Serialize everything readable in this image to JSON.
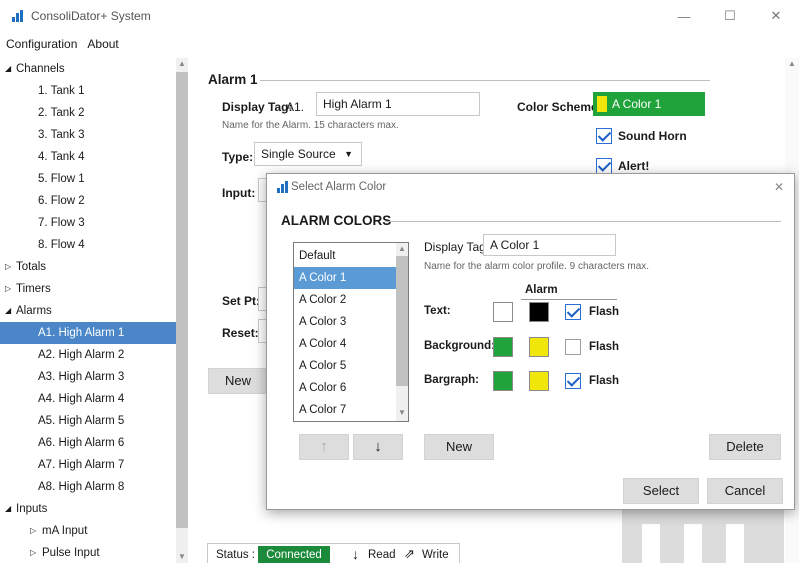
{
  "window": {
    "title": "ConsoliDator+ System",
    "minimize_glyph": "—",
    "maximize_glyph": "☐",
    "close_glyph": "✕"
  },
  "menu": [
    "Configuration",
    "About"
  ],
  "tree": [
    {
      "label": "Channels",
      "level": 0,
      "toggle": "◢"
    },
    {
      "label": "1. Tank 1",
      "level": 1
    },
    {
      "label": "2. Tank 2",
      "level": 1
    },
    {
      "label": "3. Tank  3",
      "level": 1
    },
    {
      "label": "4. Tank 4",
      "level": 1
    },
    {
      "label": "5. Flow 1",
      "level": 1
    },
    {
      "label": "6. Flow 2",
      "level": 1
    },
    {
      "label": "7. Flow 3",
      "level": 1
    },
    {
      "label": "8. Flow 4",
      "level": 1
    },
    {
      "label": "Totals",
      "level": 0,
      "toggle": "▷"
    },
    {
      "label": "Timers",
      "level": 0,
      "toggle": "▷"
    },
    {
      "label": "Alarms",
      "level": 0,
      "toggle": "◢"
    },
    {
      "label": "A1. High Alarm 1",
      "level": 1,
      "selected": true
    },
    {
      "label": "A2. High Alarm 2",
      "level": 1
    },
    {
      "label": "A3. High Alarm 3",
      "level": 1
    },
    {
      "label": "A4. High Alarm 4",
      "level": 1
    },
    {
      "label": "A5. High Alarm 5",
      "level": 1
    },
    {
      "label": "A6. High Alarm 6",
      "level": 1
    },
    {
      "label": "A7. High Alarm 7",
      "level": 1
    },
    {
      "label": "A8. High Alarm 8",
      "level": 1
    },
    {
      "label": "Inputs",
      "level": 0,
      "toggle": "◢"
    },
    {
      "label": "mA Input",
      "level": 1,
      "toggle": "▷"
    },
    {
      "label": "Pulse Input",
      "level": 1,
      "toggle": "▷"
    }
  ],
  "alarm": {
    "section_title": "Alarm 1",
    "display_tag_label": "Display Tag:",
    "display_tag_prefix": "A1.",
    "display_tag_value": "High Alarm 1",
    "display_tag_hint": "Name for the Alarm. 15 characters max.",
    "color_scheme_label": "Color Scheme:",
    "color_scheme_value": "A Color 1",
    "sound_horn_label": "Sound Horn",
    "alert_label": "Alert!",
    "type_label": "Type:",
    "type_value": "Single Source",
    "input_label": "Input:",
    "set_pt_label": "Set Pt:",
    "reset_label": "Reset:",
    "new_button": "New"
  },
  "status": {
    "label": "Status :",
    "value": "Connected",
    "read": "Read",
    "write": "Write"
  },
  "dialog": {
    "title": "Select Alarm Color",
    "section_title": "ALARM COLORS",
    "list": [
      "Default",
      "A Color 1",
      "A Color 2",
      "A Color 3",
      "A Color 4",
      "A Color 5",
      "A Color 6",
      "A Color 7"
    ],
    "selected_index": 1,
    "display_tag_label": "Display Tag:",
    "display_tag_value": "A Color 1",
    "display_tag_hint": "Name for the alarm color profile. 9 characters max.",
    "alarm_header": "Alarm",
    "rows": [
      {
        "label": "Text:",
        "normal_color": "#ffffff",
        "alarm_color": "#000000",
        "flash": true
      },
      {
        "label": "Background:",
        "normal_color": "#1fa33a",
        "alarm_color": "#f0e60a",
        "flash": false
      },
      {
        "label": "Bargraph:",
        "normal_color": "#1fa33a",
        "alarm_color": "#f0e60a",
        "flash": true
      }
    ],
    "flash_label": "Flash",
    "up_glyph": "↑",
    "down_glyph": "↓",
    "new_button": "New",
    "delete_button": "Delete",
    "select_button": "Select",
    "cancel_button": "Cancel",
    "close_glyph": "✕"
  },
  "colors": {
    "accent": "#4a86c8",
    "scheme_green": "#1fa33a",
    "scheme_yellow": "#f0e60a",
    "connected_green": "#1b8a3a"
  }
}
